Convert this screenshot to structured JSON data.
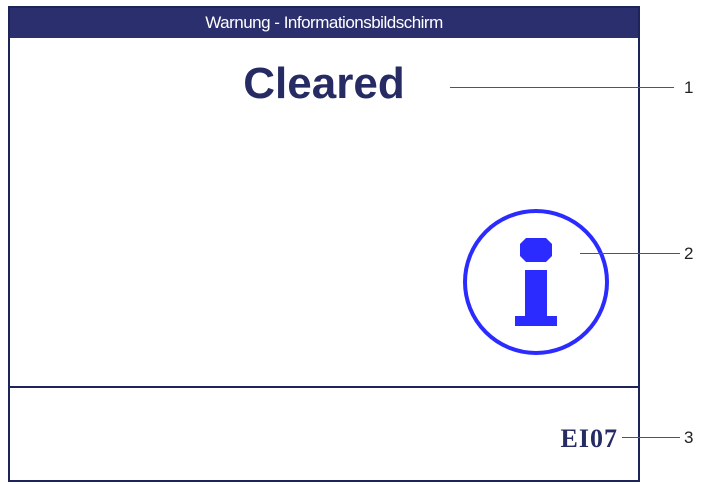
{
  "window": {
    "title": "Warnung - Informationsbildschirm"
  },
  "main": {
    "status_text": "Cleared",
    "icon": "info-circle-icon"
  },
  "footer": {
    "error_code": "EI07"
  },
  "callouts": {
    "one": "1",
    "two": "2",
    "three": "3"
  },
  "colors": {
    "title_bar": "#2b2f6e",
    "text": "#262c63",
    "icon": "#2b2bff"
  }
}
